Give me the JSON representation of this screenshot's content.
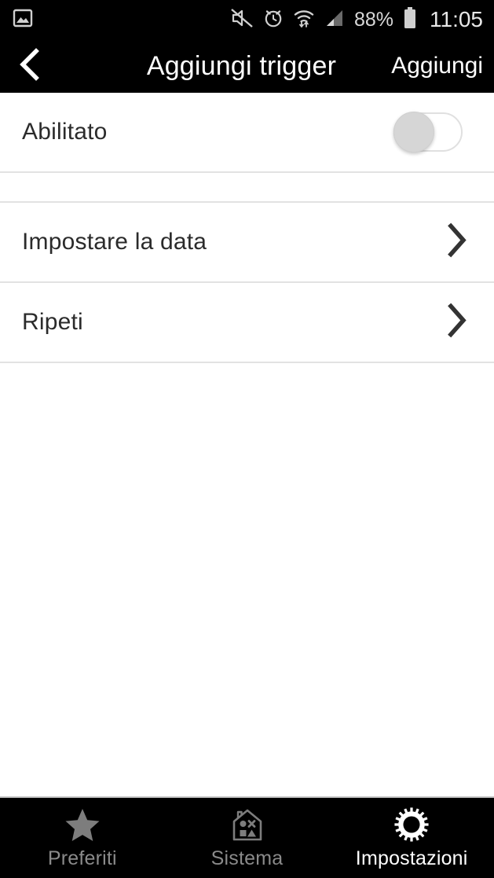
{
  "status_bar": {
    "notification_icon": "image-notification-icon",
    "icons": [
      "mute-icon",
      "alarm-clock-icon",
      "wifi-icon",
      "signal-bars-icon"
    ],
    "battery_percent": "88%",
    "battery_icon": "battery-icon",
    "time": "11:05"
  },
  "title_bar": {
    "back_icon": "chevron-left-icon",
    "title": "Aggiungi trigger",
    "action_label": "Aggiungi"
  },
  "content": {
    "toggle_row": {
      "label": "Abilitato",
      "toggle_state": "off"
    },
    "nav_rows": [
      {
        "label": "Impostare la data",
        "chevron": "chevron-right-icon"
      },
      {
        "label": "Ripeti",
        "chevron": "chevron-right-icon"
      }
    ]
  },
  "tab_bar": {
    "tabs": [
      {
        "label": "Preferiti",
        "icon": "star-icon",
        "active": false
      },
      {
        "label": "Sistema",
        "icon": "house-devices-icon",
        "active": false
      },
      {
        "label": "Impostazioni",
        "icon": "gear-icon",
        "active": true
      }
    ]
  },
  "colors": {
    "bar_background": "#000000",
    "content_background": "#ffffff",
    "divider": "#e2e2e2",
    "text_primary": "#2b2b2b",
    "tab_inactive": "#8a8a8a",
    "tab_active": "#ffffff"
  }
}
